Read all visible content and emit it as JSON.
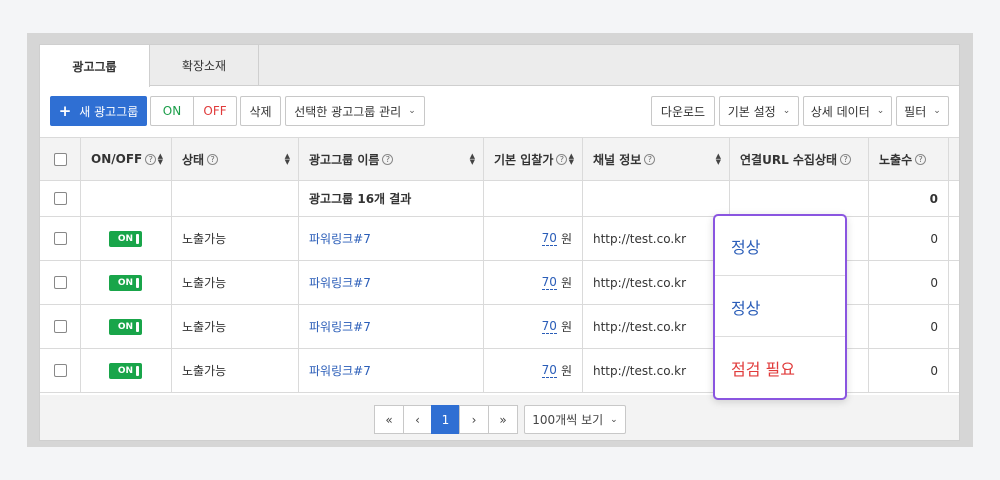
{
  "tabs": [
    {
      "label": "광고그룹",
      "active": true
    },
    {
      "label": "확장소재",
      "active": false
    }
  ],
  "toolbar": {
    "new_button": "새 광고그룹",
    "on_label": "ON",
    "off_label": "OFF",
    "delete_label": "삭제",
    "manage_label": "선택한 광고그룹 관리",
    "download_label": "다운로드",
    "default_settings_label": "기본 설정",
    "detail_data_label": "상세 데이터",
    "filter_label": "필터"
  },
  "columns": {
    "onoff": "ON/OFF",
    "status": "상태",
    "name": "광고그룹 이름",
    "bid": "기본 입찰가",
    "channel": "채널 정보",
    "url_status": "연결URL 수집상태",
    "impressions": "노출수"
  },
  "summary": {
    "label": "광고그룹 16개 결과",
    "impressions": "0"
  },
  "rows": [
    {
      "toggle": "ON",
      "status": "노출가능",
      "name": "파워링크#7",
      "bid": "70",
      "bid_unit": "원",
      "channel": "http://test.co.kr",
      "impressions": "0"
    },
    {
      "toggle": "ON",
      "status": "노출가능",
      "name": "파워링크#7",
      "bid": "70",
      "bid_unit": "원",
      "channel": "http://test.co.kr",
      "impressions": "0"
    },
    {
      "toggle": "ON",
      "status": "노출가능",
      "name": "파워링크#7",
      "bid": "70",
      "bid_unit": "원",
      "channel": "http://test.co.kr",
      "impressions": "0"
    },
    {
      "toggle": "ON",
      "status": "노출가능",
      "name": "파워링크#7",
      "bid": "70",
      "bid_unit": "원",
      "channel": "http://test.co.kr",
      "impressions": "0"
    }
  ],
  "url_status_popup": [
    {
      "label": "정상",
      "type": "ok"
    },
    {
      "label": "정상",
      "type": "ok"
    },
    {
      "label": "점검 필요",
      "type": "warn"
    }
  ],
  "pagination": {
    "first": "«",
    "prev": "‹",
    "current": "1",
    "next": "›",
    "last": "»",
    "page_size": "100개씩 보기"
  },
  "colors": {
    "primary": "#2f6fd3",
    "on_green": "#19a54a",
    "off_red": "#e03b3b",
    "popup_border": "#8a55e0"
  }
}
